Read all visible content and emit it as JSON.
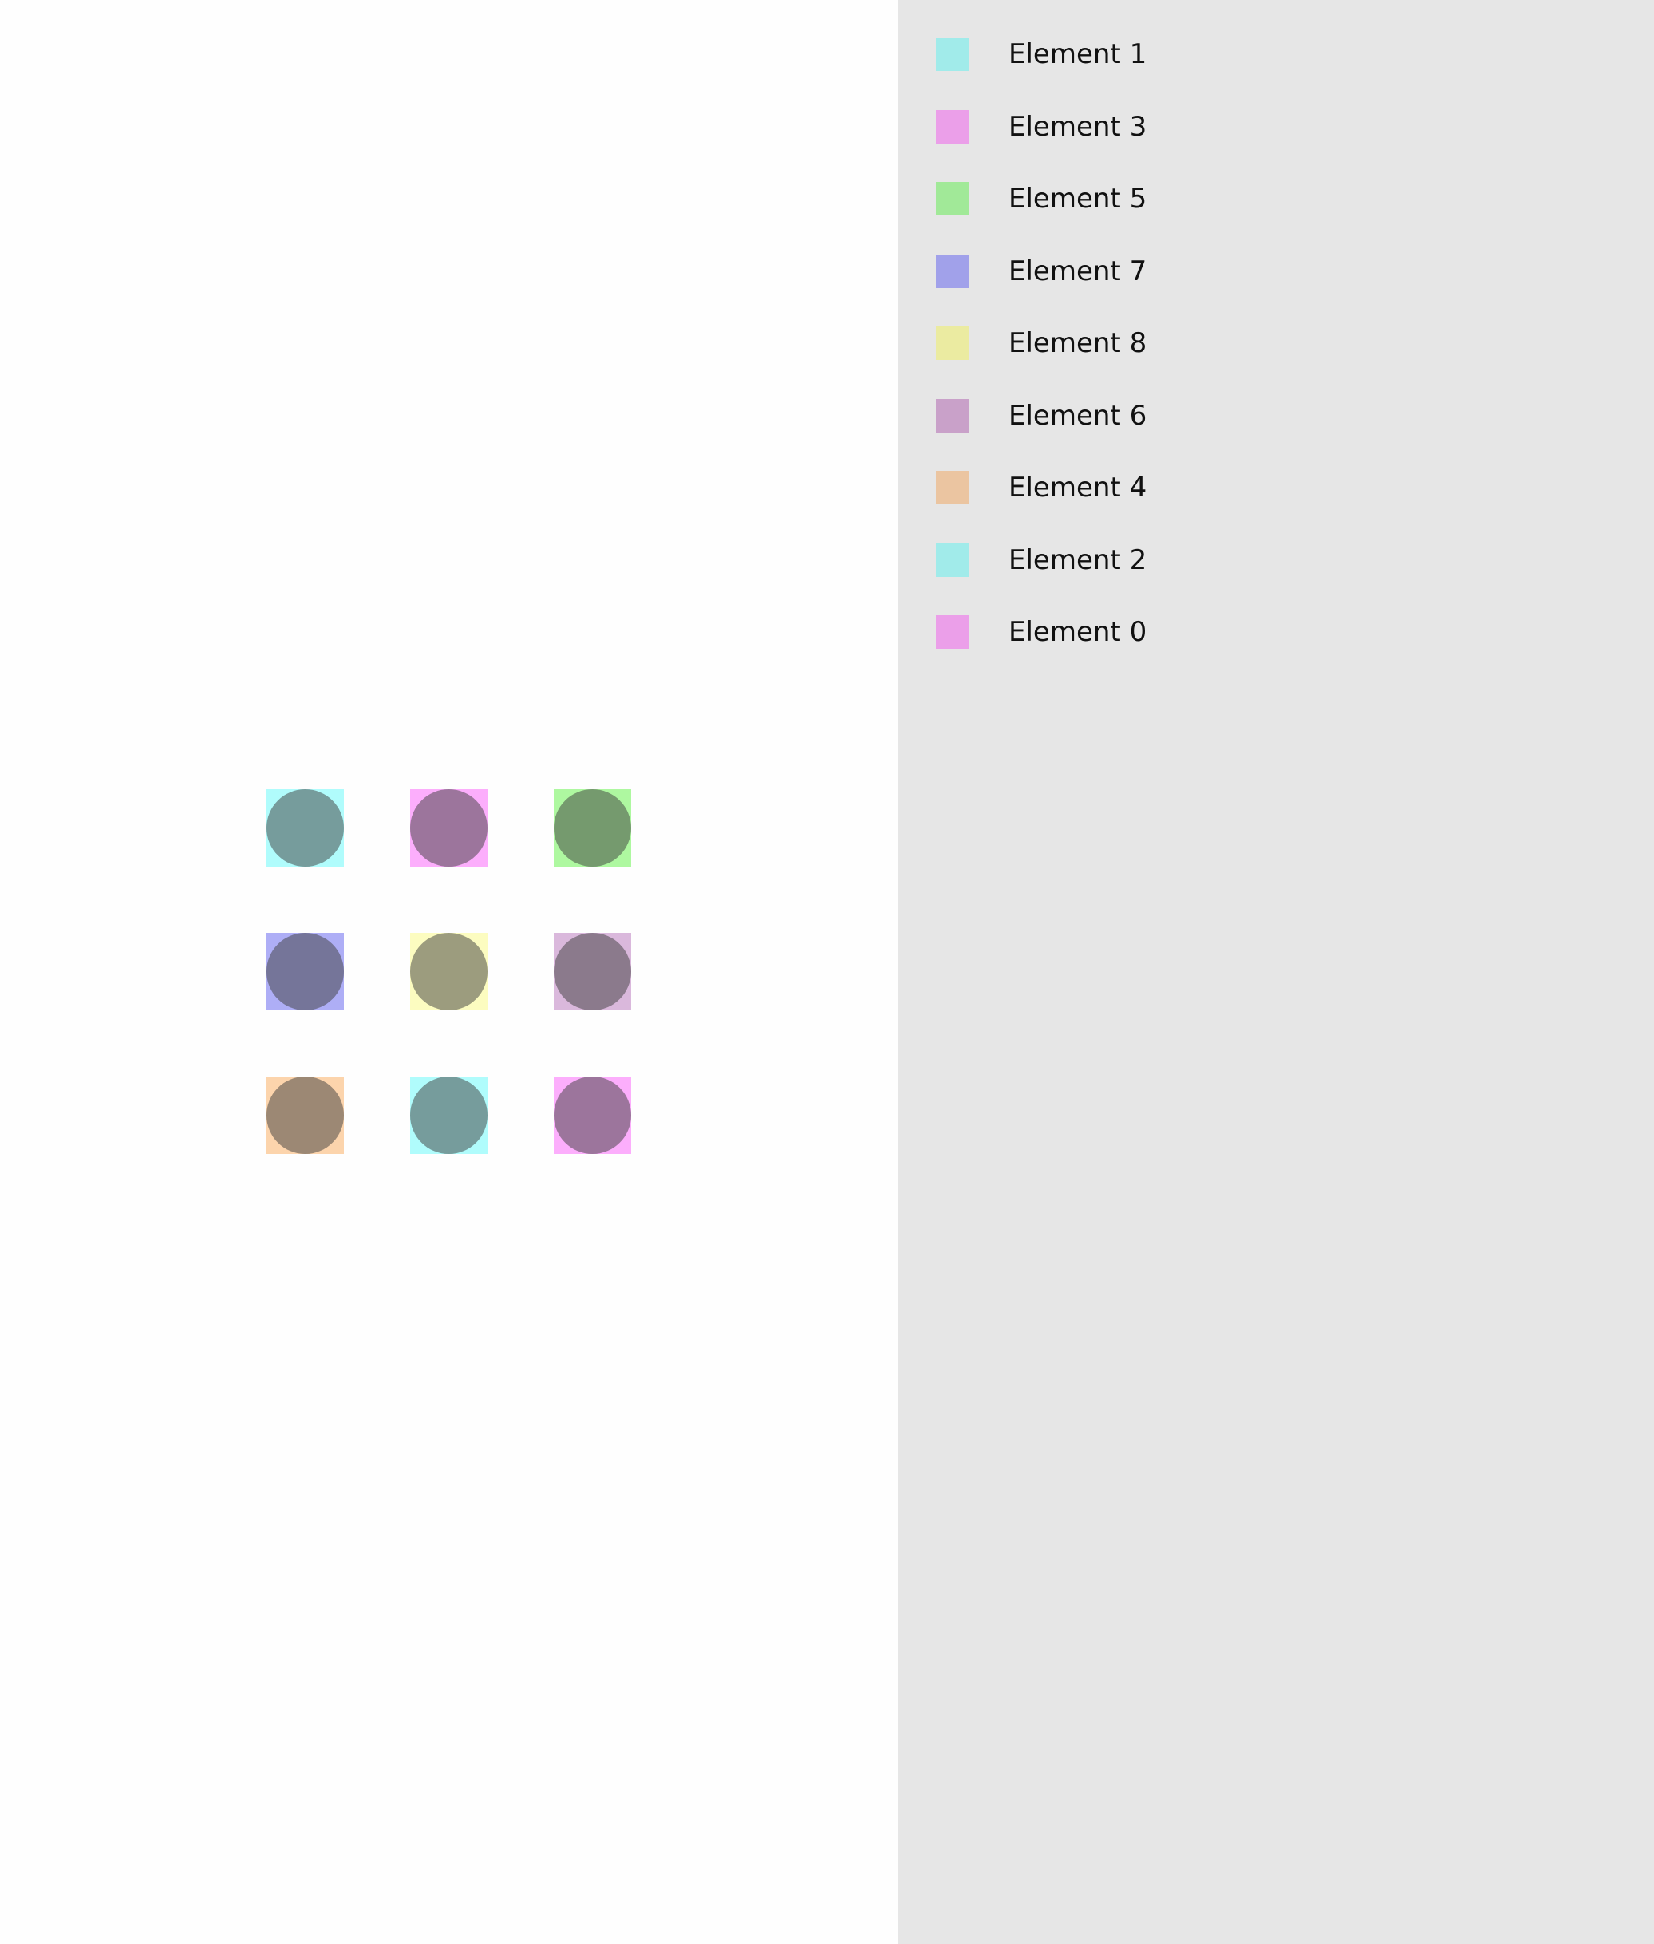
{
  "canvas": {
    "elements": [
      {
        "id": "element-1",
        "color": "#b0fcfc"
      },
      {
        "id": "element-3",
        "color": "#fcaefc"
      },
      {
        "id": "element-5",
        "color": "#aef8a0"
      },
      {
        "id": "element-7",
        "color": "#aeaef6"
      },
      {
        "id": "element-8",
        "color": "#fcfcc0"
      },
      {
        "id": "element-6",
        "color": "#dab8dc"
      },
      {
        "id": "element-4",
        "color": "#fcd4ac"
      },
      {
        "id": "element-2",
        "color": "#b0fcfc"
      },
      {
        "id": "element-0",
        "color": "#fcaefc"
      }
    ]
  },
  "legend": {
    "items": [
      {
        "label": "Element 1",
        "color": "#a1ebea"
      },
      {
        "label": "Element 3",
        "color": "#eb9fe9"
      },
      {
        "label": "Element 5",
        "color": "#a1e998"
      },
      {
        "label": "Element 7",
        "color": "#a1a1ea"
      },
      {
        "label": "Element 8",
        "color": "#ebeba1"
      },
      {
        "label": "Element 6",
        "color": "#c9a1c9"
      },
      {
        "label": "Element 4",
        "color": "#ebc5a1"
      },
      {
        "label": "Element 2",
        "color": "#a1ebea"
      },
      {
        "label": "Element 0",
        "color": "#eb9fe9"
      }
    ]
  }
}
